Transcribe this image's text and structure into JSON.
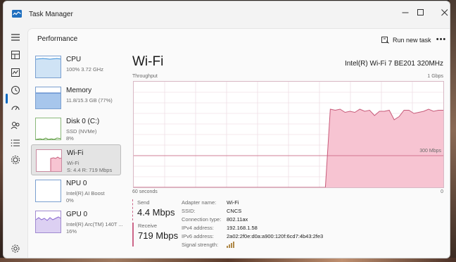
{
  "window": {
    "title": "Task Manager"
  },
  "header": {
    "page_title": "Performance",
    "run_task_label": "Run new task"
  },
  "perf_items": [
    {
      "name": "CPU",
      "line1": "100%  3.72 GHz",
      "line2": ""
    },
    {
      "name": "Memory",
      "line1": "11.8/15.3 GB (77%)",
      "line2": ""
    },
    {
      "name": "Disk 0 (C:)",
      "line1": "SSD (NVMe)",
      "line2": "8%"
    },
    {
      "name": "Wi-Fi",
      "line1": "Wi-Fi",
      "line2": "S: 4.4  R: 719 Mbps"
    },
    {
      "name": "NPU 0",
      "line1": "Intel(R) AI Boost",
      "line2": "0%"
    },
    {
      "name": "GPU 0",
      "line1": "Intel(R) Arc(TM) 140T ...",
      "line2": "16%"
    }
  ],
  "detail": {
    "title": "Wi-Fi",
    "adapter": "Intel(R) Wi-Fi 7 BE201 320MHz",
    "graph": {
      "y_label": "Throughput",
      "y_max": "1 Gbps",
      "mid_label": "300 Mbps",
      "x_left": "60 seconds",
      "x_right": "0",
      "throughput_fraction": [
        0,
        0,
        0,
        0,
        0,
        0,
        0,
        0,
        0,
        0,
        0,
        0,
        0,
        0,
        0,
        0,
        0,
        0,
        0,
        0,
        0,
        0,
        0,
        0,
        0,
        0,
        0,
        0,
        0,
        0,
        0,
        0,
        0,
        0,
        0,
        0,
        0,
        0,
        0,
        0,
        0.74,
        0.73,
        0.74,
        0.71,
        0.72,
        0.71,
        0.74,
        0.72,
        0.73,
        0.68,
        0.72,
        0.72,
        0.73,
        0.64,
        0.67,
        0.73,
        0.73,
        0.7,
        0.71,
        0.72,
        0.74,
        0.72,
        0.73,
        0.73
      ],
      "colors": {
        "line": "#c75b7a",
        "fill": "#f7c4d2",
        "grid": "#ead6de"
      }
    },
    "send": {
      "label": "Send",
      "value": "4.4 Mbps"
    },
    "receive": {
      "label": "Receive",
      "value": "719 Mbps"
    },
    "properties": [
      {
        "label": "Adapter name:",
        "value": "Wi-Fi"
      },
      {
        "label": "SSID:",
        "value": "CNCS"
      },
      {
        "label": "Connection type:",
        "value": "802.11ax"
      },
      {
        "label": "IPv4 address:",
        "value": "192.168.1.58"
      },
      {
        "label": "IPv6 address:",
        "value": "2a02:2f0e:d0a:a900:120f:6cd7:4b43:2fe3"
      },
      {
        "label": "Signal strength:",
        "value": ""
      }
    ]
  },
  "icons": {
    "nav": [
      "hamburger-icon",
      "processes-icon",
      "performance-icon",
      "app-history-icon",
      "startup-apps-icon",
      "users-icon",
      "details-icon",
      "services-icon",
      "settings-icon"
    ]
  }
}
